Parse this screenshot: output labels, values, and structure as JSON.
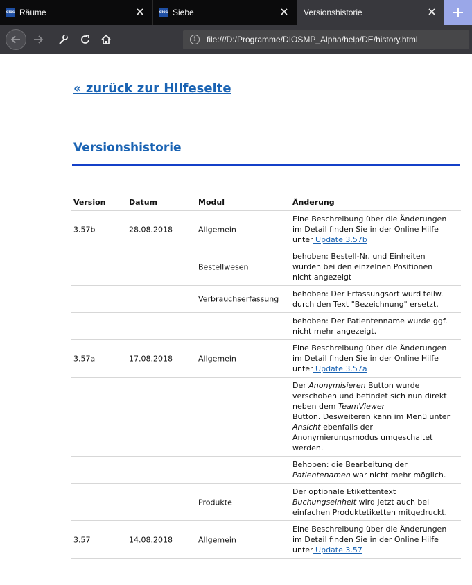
{
  "browser": {
    "tabs": [
      {
        "favicon": "dios",
        "title": "Räume"
      },
      {
        "favicon": "dios",
        "title": "Siebe"
      },
      {
        "favicon": "",
        "title": "Versionshistorie"
      }
    ],
    "url": "file:///D:/Programme/DIOSMP_Alpha/help/DE/history.html",
    "colors": {
      "tabbar": "#0b0b0c",
      "toolbar": "#38383d",
      "newtab": "#9aa7e8"
    }
  },
  "page": {
    "back_link": "« zurück zur Hilfeseite",
    "title": "Versionshistorie",
    "accent": "#1a63b3",
    "rule_color": "#1440c8"
  },
  "table": {
    "headers": {
      "version": "Version",
      "date": "Datum",
      "module": "Modul",
      "change": "Änderung"
    },
    "rows": [
      {
        "version": "3.57b",
        "date": "28.08.2018",
        "module": "Allgemein",
        "lines": [
          {
            "text": "Eine Beschreibung über die Änderungen"
          },
          {
            "text": "im Detail finden Sie in der Online Hilfe"
          },
          {
            "prefix": "unter",
            "link": " Update 3.57b"
          }
        ]
      },
      {
        "version": "",
        "date": "",
        "module": "Bestellwesen",
        "lines": [
          {
            "text": "behoben: Bestell-Nr. und Einheiten"
          },
          {
            "text": "wurden bei den einzelnen Positionen"
          },
          {
            "text": "nicht angezeigt"
          }
        ]
      },
      {
        "version": "",
        "date": "",
        "module": "Verbrauchserfassung",
        "lines": [
          {
            "text": "behoben: Der Erfassungsort wurd teilw."
          },
          {
            "text": "durch den Text \"Bezeichnung\" ersetzt."
          }
        ]
      },
      {
        "version": "",
        "date": "",
        "module": "",
        "lines": [
          {
            "text": "behoben: Der Patientenname wurde ggf."
          },
          {
            "text": "nicht mehr  angezeigt."
          }
        ]
      },
      {
        "version": "3.57a",
        "date": "17.08.2018",
        "module": "Allgemein",
        "lines": [
          {
            "text": "Eine Beschreibung über die Änderungen"
          },
          {
            "text": "im Detail finden Sie in der Online Hilfe"
          },
          {
            "prefix": "unter",
            "link": " Update 3.57a"
          }
        ]
      },
      {
        "version": "",
        "date": "",
        "module": "",
        "lines": [
          {
            "text": "Der ",
            "italic": "Anonymisieren",
            "after": " Button wurde"
          },
          {
            "text": "verschoben und befindet sich nun direkt"
          },
          {
            "text": "neben dem ",
            "italic": "TeamViewer"
          },
          {
            "text": "Button. Desweiteren kann im Menü unter"
          },
          {
            "italic": "Ansicht",
            "after": " ebenfalls der"
          },
          {
            "text": "Anonymierungsmodus umgeschaltet"
          },
          {
            "text": "werden."
          }
        ]
      },
      {
        "version": "",
        "date": "",
        "module": "",
        "lines": [
          {
            "text": "Behoben: die Bearbeitung der"
          },
          {
            "italic": "Patientenamen",
            "after": " war nicht mehr möglich."
          }
        ]
      },
      {
        "version": "",
        "date": "",
        "module": "Produkte",
        "lines": [
          {
            "text": "Der optionale Etikettentext"
          },
          {
            "italic": "Buchungseinheit",
            "after": " wird jetzt auch bei"
          },
          {
            "text": "einfachen Produktetiketten mitgedruckt."
          }
        ]
      },
      {
        "version": "3.57",
        "date": "14.08.2018",
        "module": "Allgemein",
        "lines": [
          {
            "text": "Eine Beschreibung über die Änderungen"
          },
          {
            "text": "im Detail finden Sie in der Online Hilfe"
          },
          {
            "prefix": "unter",
            "link": " Update 3.57"
          }
        ]
      }
    ]
  }
}
